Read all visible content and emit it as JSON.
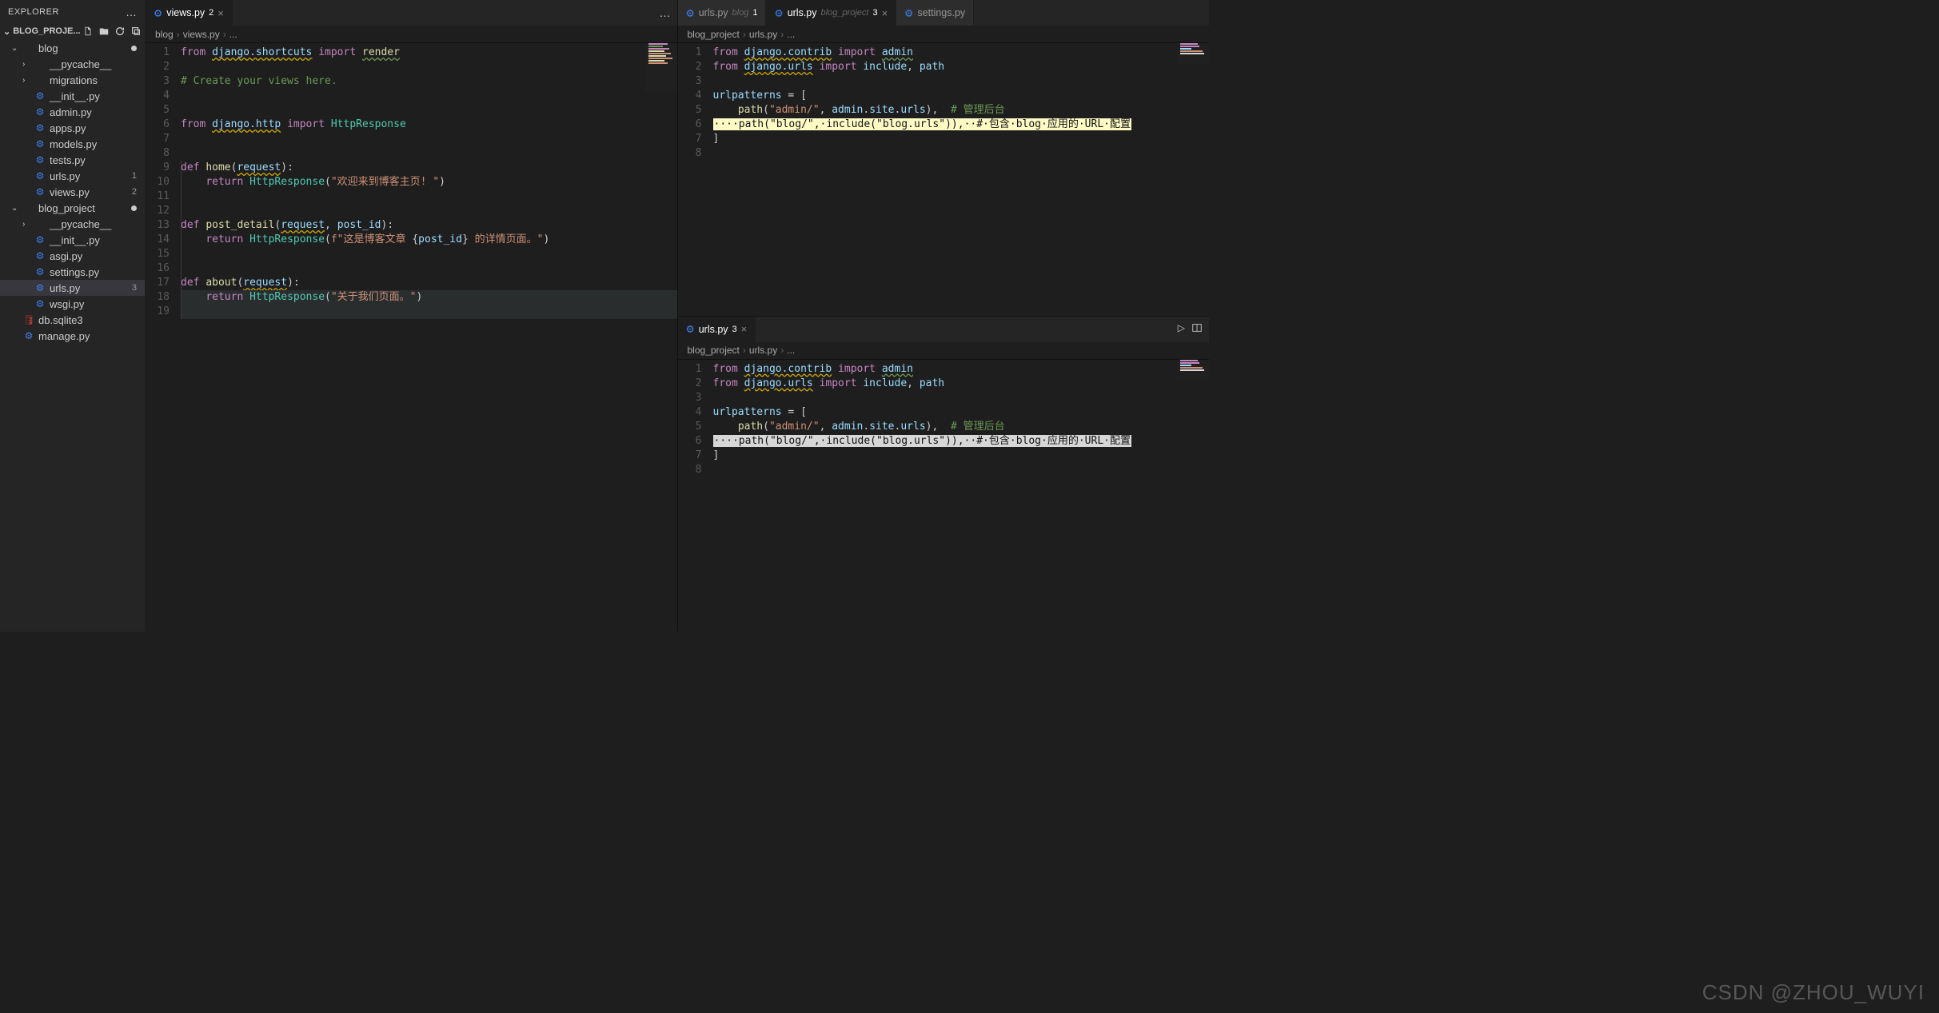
{
  "explorer": {
    "title": "EXPLORER",
    "project": "BLOG_PROJE...",
    "header_icons": [
      "new-file",
      "new-folder",
      "refresh",
      "collapse"
    ],
    "tree": [
      {
        "type": "folder",
        "name": "blog",
        "expanded": true,
        "modified": true,
        "indent": 1
      },
      {
        "type": "folder",
        "name": "__pycache__",
        "expanded": false,
        "indent": 2
      },
      {
        "type": "folder",
        "name": "migrations",
        "expanded": false,
        "indent": 2
      },
      {
        "type": "py",
        "name": "__init__.py",
        "indent": 2
      },
      {
        "type": "py",
        "name": "admin.py",
        "indent": 2
      },
      {
        "type": "py",
        "name": "apps.py",
        "indent": 2
      },
      {
        "type": "py",
        "name": "models.py",
        "indent": 2
      },
      {
        "type": "py",
        "name": "tests.py",
        "indent": 2
      },
      {
        "type": "py",
        "name": "urls.py",
        "indent": 2,
        "badge": "1"
      },
      {
        "type": "py",
        "name": "views.py",
        "indent": 2,
        "badge": "2"
      },
      {
        "type": "folder",
        "name": "blog_project",
        "expanded": true,
        "modified": true,
        "indent": 1
      },
      {
        "type": "folder",
        "name": "__pycache__",
        "expanded": false,
        "indent": 2
      },
      {
        "type": "py",
        "name": "__init__.py",
        "indent": 2
      },
      {
        "type": "py",
        "name": "asgi.py",
        "indent": 2
      },
      {
        "type": "py",
        "name": "settings.py",
        "indent": 2
      },
      {
        "type": "py",
        "name": "urls.py",
        "indent": 2,
        "badge": "3",
        "active": true
      },
      {
        "type": "py",
        "name": "wsgi.py",
        "indent": 2
      },
      {
        "type": "db",
        "name": "db.sqlite3",
        "indent": 1
      },
      {
        "type": "py",
        "name": "manage.py",
        "indent": 1
      }
    ]
  },
  "leftGroup": {
    "tabs": [
      {
        "name": "views.py",
        "mod": "2",
        "close": true,
        "active": true
      }
    ],
    "breadcrumb": [
      "blog",
      "views.py",
      "..."
    ],
    "overflow": "…",
    "lines_count": 19
  },
  "rightTop": {
    "tabs": [
      {
        "name": "urls.py",
        "qual": "blog",
        "mod": "1"
      },
      {
        "name": "urls.py",
        "qual": "blog_project",
        "mod": "3",
        "close": true,
        "active": true
      },
      {
        "name": "settings.py"
      }
    ],
    "breadcrumb": [
      "blog_project",
      "urls.py",
      "..."
    ],
    "lines_count": 8
  },
  "rightBottom": {
    "tabs": [
      {
        "name": "urls.py",
        "mod": "3",
        "close": true,
        "active": true
      }
    ],
    "breadcrumb": [
      "blog_project",
      "urls.py",
      "..."
    ],
    "actions": [
      "run",
      "split",
      "more"
    ],
    "lines_count": 8
  },
  "codeViews": {
    "views_py": [
      "from django.shortcuts import render",
      "",
      "# Create your views here.",
      "",
      "",
      "from django.http import HttpResponse",
      "",
      "",
      "def home(request):",
      "    return HttpResponse(\"欢迎来到博客主页! \")",
      "",
      "",
      "def post_detail(request, post_id):",
      "    return HttpResponse(f\"这是博客文章 {post_id} 的详情页面。\")",
      "",
      "",
      "def about(request):",
      "    return HttpResponse(\"关于我们页面。\")",
      ""
    ],
    "urls_project_py": [
      "from django.contrib import admin",
      "from django.urls import include, path",
      "",
      "urlpatterns = [",
      "    path(\"admin/\", admin.site.urls),  # 管理后台",
      "    path(\"blog/\", include(\"blog.urls\")),  # 包含 blog 应用的 URL 配置",
      "]",
      ""
    ],
    "selected_line": "····path(\"blog/\",·include(\"blog.urls\")),··#·包含·blog·应用的·URL·配置"
  },
  "watermark": "CSDN @ZHOU_WUYI"
}
